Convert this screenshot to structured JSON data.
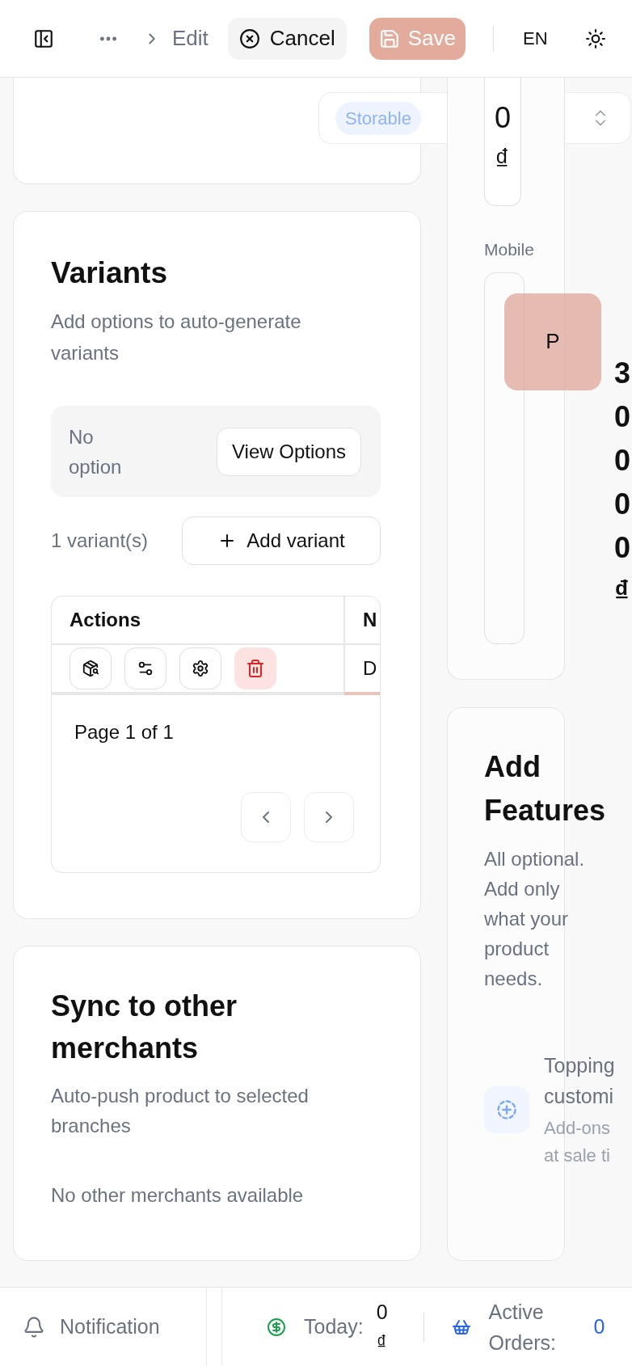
{
  "toolbar": {
    "breadcrumb_current": "Edit",
    "cancel_button": "Cancel",
    "save_button": {
      "label": "Save",
      "disabled": true
    },
    "language": "EN"
  },
  "general_card": {
    "badge": "Storable"
  },
  "price_card": {
    "price": "0 ₫",
    "mobile_label": "Mobile",
    "tile_letter": "P",
    "mobile_price": "30000 ₫"
  },
  "variants": {
    "title": "Variants",
    "description": "Add options to auto-generate variants",
    "options_empty": "No option",
    "view_options_button": "View Options",
    "count": "1 variant(s)",
    "add_variant_button": "Add variant",
    "table": {
      "columns": [
        "Actions",
        "N"
      ],
      "rows": [
        {
          "actions": [
            {
              "kind": "inspect"
            },
            {
              "kind": "adjust"
            },
            {
              "kind": "settings"
            },
            {
              "kind": "delete"
            }
          ],
          "column_2": "D"
        }
      ]
    },
    "pagination": "Page 1 of 1"
  },
  "features": {
    "title": "Add Features",
    "description": "All optional. Add only what your product needs.",
    "items": [
      {
        "title": "Topping customi",
        "description": "Add-ons at sale ti"
      }
    ]
  },
  "sync": {
    "title": "Sync to other merchants",
    "description": "Auto-push product to selected branches",
    "empty": "No other merchants available"
  },
  "status_bar": {
    "notification": "Notification",
    "today_label": "Today:",
    "today_value": "0 ₫",
    "active_orders_label": "Active Orders:",
    "active_orders_value": "0"
  }
}
